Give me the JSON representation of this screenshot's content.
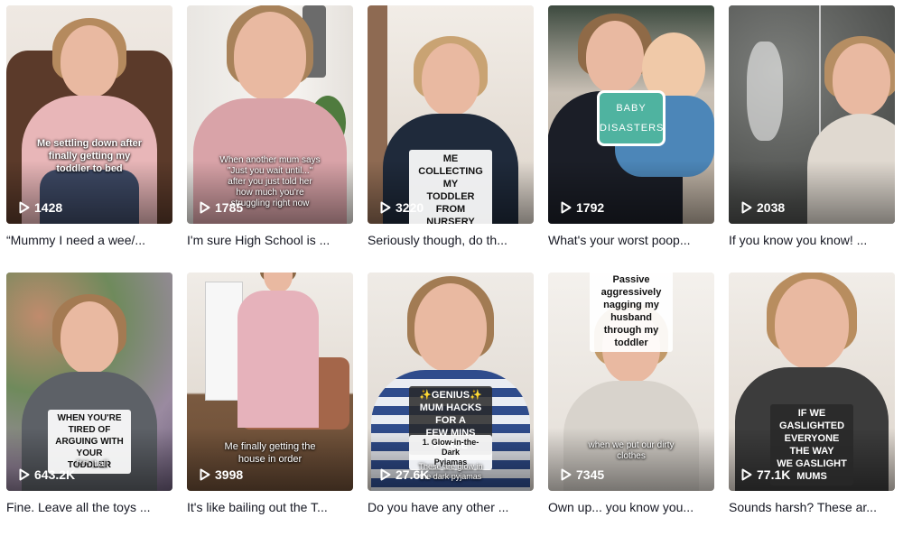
{
  "videos": [
    {
      "caption": "Me settling down after\nfinally getting my\ntoddler to bed",
      "views": "1428",
      "title": "“Mummy I need a wee/..."
    },
    {
      "caption": "When another mum says\n\"Just you wait until...\"\nafter you just told her\nhow much you're\nstruggling right now",
      "views": "1785",
      "title": "I'm sure High School is ..."
    },
    {
      "caption": "ME COLLECTING MY\nTODDLER FROM\nNURSERY",
      "views": "3220",
      "title": "Seriously though, do th..."
    },
    {
      "caption": "BABY\nDISASTERS",
      "views": "1792",
      "title": "What's your worst poop..."
    },
    {
      "caption": "",
      "views": "2038",
      "title": "If you know you know! ..."
    },
    {
      "caption": "WHEN YOU'RE TIRED OF\nARGUING WITH YOUR\nTODDLER",
      "caption2": "f*** it all",
      "views": "643.2K",
      "title": "Fine. Leave all the toys ..."
    },
    {
      "caption": "Me finally getting the\nhouse in order",
      "views": "3998",
      "title": "It's like bailing out the T..."
    },
    {
      "caption": "✨GENIUS✨\nMUM HACKS FOR A\nFEW MINS PEACE",
      "caption2": "1. Glow-in-the-Dark\nPyjamas",
      "caption3": "These are glow in\nthe dark pyjamas",
      "views": "27.6K",
      "title": "Do you have any other ..."
    },
    {
      "caption": "Passive aggressively\nnagging my husband\nthrough my toddler",
      "caption2": "when we put our dirty\nclothes",
      "views": "7345",
      "title": "Own up... you know you..."
    },
    {
      "caption": "IF WE GASLIGHTED\nEVERYONE THE WAY\nWE GASLIGHT MUMS",
      "views": "77.1K",
      "title": "Sounds harsh? These ar..."
    }
  ],
  "colors": {
    "text": "#161823",
    "badge": "#4fb3a0"
  }
}
